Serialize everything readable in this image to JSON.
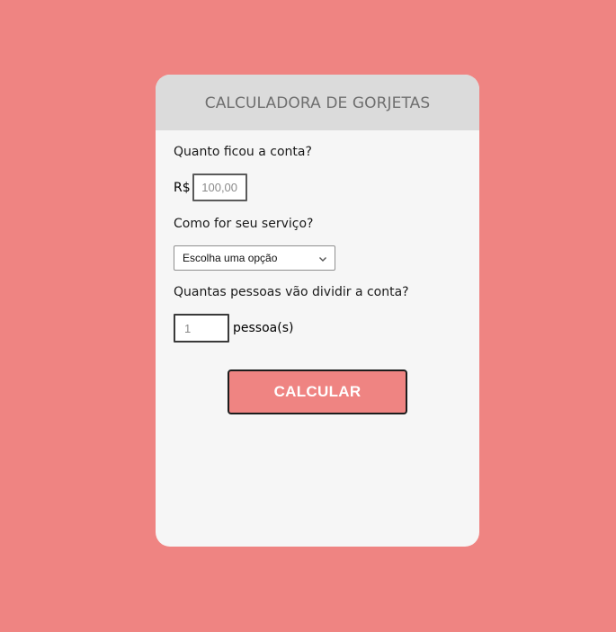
{
  "card": {
    "title": "CALCULADORA DE GORJETAS"
  },
  "bill": {
    "question": "Quanto ficou a conta?",
    "currency": "R$",
    "placeholder": "100,00",
    "value": ""
  },
  "service": {
    "question": "Como for seu serviço?",
    "selected": "Escolha uma opção"
  },
  "people": {
    "question": "Quantas pessoas vão dividir a conta?",
    "value": "1",
    "suffix": "pessoa(s)"
  },
  "button": {
    "label": "CALCULAR"
  },
  "colors": {
    "background": "#ef8482",
    "card": "#f6f6f6",
    "header": "#dbdbdb",
    "button": "#ef8482"
  },
  "icons": {
    "select_arrow": "chevron-down-icon"
  }
}
